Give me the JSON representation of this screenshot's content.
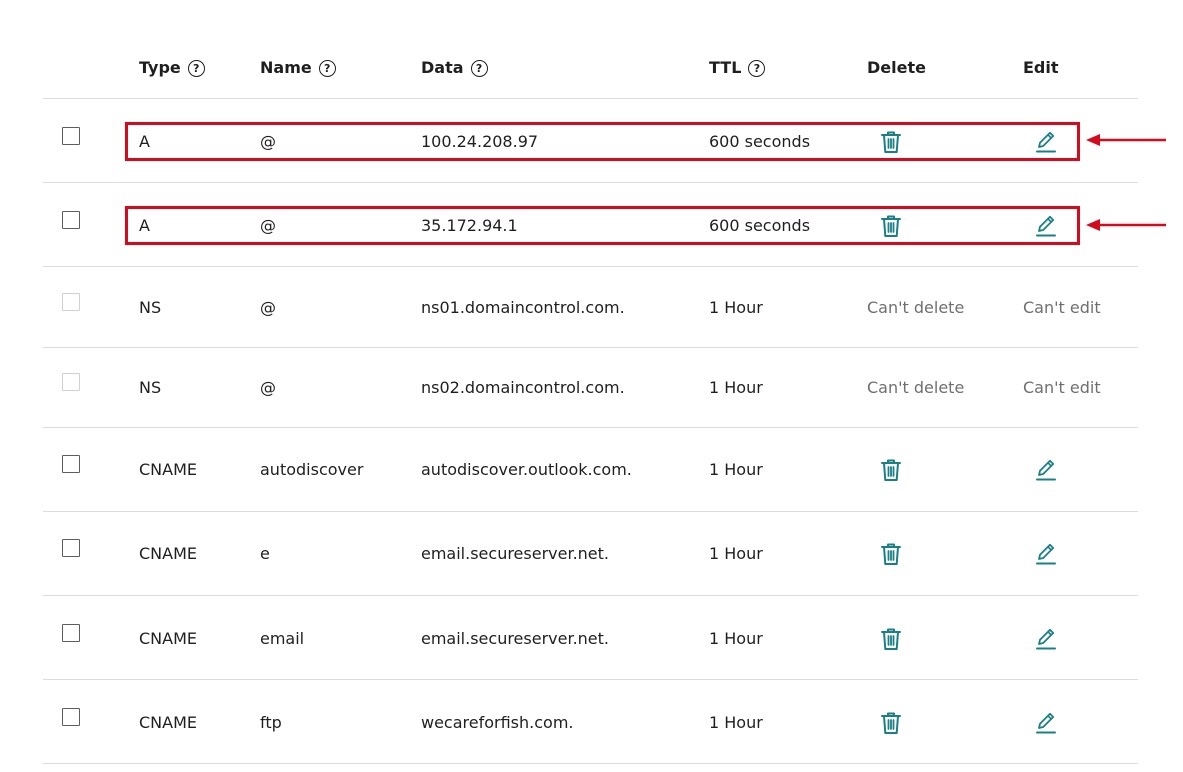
{
  "header": {
    "type": "Type",
    "name": "Name",
    "data": "Data",
    "ttl": "TTL",
    "delete": "Delete",
    "edit": "Edit",
    "help_glyph": "?"
  },
  "colors": {
    "text": "#1f1f1f",
    "muted": "#6f6f6f",
    "icon_teal": "#1a7f86",
    "highlight_red": "#d60a1c",
    "divider": "#dcdcdc"
  },
  "records": [
    {
      "type": "A",
      "name": "@",
      "data": "100.24.208.97",
      "ttl": "600 seconds",
      "editable": true
    },
    {
      "type": "A",
      "name": "@",
      "data": "35.172.94.1",
      "ttl": "600 seconds",
      "editable": true
    },
    {
      "type": "NS",
      "name": "@",
      "data": "ns01.domaincontrol.com.",
      "ttl": "1 Hour",
      "editable": false,
      "delete_text": "Can't delete",
      "edit_text": "Can't edit"
    },
    {
      "type": "NS",
      "name": "@",
      "data": "ns02.domaincontrol.com.",
      "ttl": "1 Hour",
      "editable": false,
      "delete_text": "Can't delete",
      "edit_text": "Can't edit"
    },
    {
      "type": "CNAME",
      "name": "autodiscover",
      "data": "autodiscover.outlook.com.",
      "ttl": "1 Hour",
      "editable": true
    },
    {
      "type": "CNAME",
      "name": "e",
      "data": "email.secureserver.net.",
      "ttl": "1 Hour",
      "editable": true
    },
    {
      "type": "CNAME",
      "name": "email",
      "data": "email.secureserver.net.",
      "ttl": "1 Hour",
      "editable": true
    },
    {
      "type": "CNAME",
      "name": "ftp",
      "data": "wecareforfish.com.",
      "ttl": "1 Hour",
      "editable": true
    }
  ],
  "icons": {
    "delete": "trash-icon",
    "edit": "pencil-icon",
    "annotation": "red-arrow-icon"
  }
}
